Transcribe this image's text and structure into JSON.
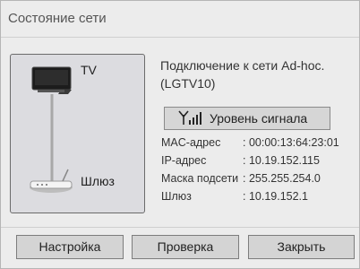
{
  "dialog": {
    "title": "Состояние сети",
    "diagram": {
      "tv_label": "TV",
      "gateway_label": "Шлюз"
    },
    "connection_text": "Подключение к сети Ad-hoc. (LGTV10)",
    "signal_button_label": "Уровень сигнала",
    "network_info": [
      {
        "key": "MAC-адрес",
        "value": ": 00:00:13:64:23:01"
      },
      {
        "key": "IP-адрес",
        "value": ": 10.19.152.115"
      },
      {
        "key": "Маска подсети",
        "value": ": 255.255.254.0"
      },
      {
        "key": "Шлюз",
        "value": ": 10.19.152.1"
      }
    ],
    "buttons": {
      "settings": "Настройка",
      "check": "Проверка",
      "close": "Закрыть"
    }
  },
  "icons": [
    "tv-icon",
    "router-icon",
    "signal-icon"
  ],
  "colors": {
    "background": "#ececec",
    "diagram_panel": "#dcdce0",
    "button": "#d4d4d4"
  }
}
